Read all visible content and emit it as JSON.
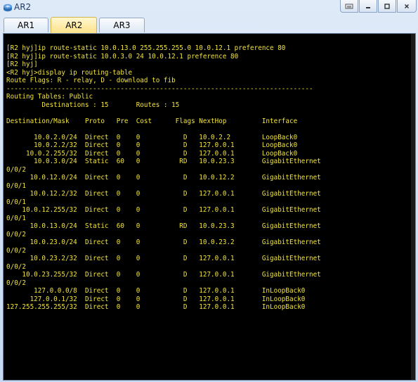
{
  "window": {
    "title": "AR2",
    "icon": "router-icon"
  },
  "tabs": [
    {
      "label": "AR1"
    },
    {
      "label": "AR2",
      "active": true
    },
    {
      "label": "AR3"
    }
  ],
  "terminal": {
    "text_color": "#f2e43a",
    "background": "#000000",
    "lines": [
      "[R2 hyj]ip route-static 10.0.13.0 255.255.255.0 10.0.12.1 preference 80",
      "[R2 hyj]ip route-static 10.0.3.0 24 10.0.12.1 preference 80",
      "[R2 hyj]",
      "<R2 hyj>display ip routing-table",
      "Route Flags: R - relay, D - download to fib",
      "------------------------------------------------------------------------------",
      "Routing Tables: Public",
      "         Destinations : 15       Routes : 15",
      "",
      "Destination/Mask    Proto   Pre  Cost      Flags NextHop         Interface",
      "",
      "       10.0.2.0/24  Direct  0    0           D   10.0.2.2        LoopBack0",
      "       10.0.2.2/32  Direct  0    0           D   127.0.0.1       LoopBack0",
      "     10.0.2.255/32  Direct  0    0           D   127.0.0.1       LoopBack0",
      "       10.0.3.0/24  Static  60   0          RD   10.0.23.3       GigabitEthernet",
      "0/0/2",
      "      10.0.12.0/24  Direct  0    0           D   10.0.12.2       GigabitEthernet",
      "0/0/1",
      "      10.0.12.2/32  Direct  0    0           D   127.0.0.1       GigabitEthernet",
      "0/0/1",
      "    10.0.12.255/32  Direct  0    0           D   127.0.0.1       GigabitEthernet",
      "0/0/1",
      "      10.0.13.0/24  Static  60   0          RD   10.0.23.3       GigabitEthernet",
      "0/0/2",
      "      10.0.23.0/24  Direct  0    0           D   10.0.23.2       GigabitEthernet",
      "0/0/2",
      "      10.0.23.2/32  Direct  0    0           D   127.0.0.1       GigabitEthernet",
      "0/0/2",
      "    10.0.23.255/32  Direct  0    0           D   127.0.0.1       GigabitEthernet",
      "0/0/2",
      "       127.0.0.0/8  Direct  0    0           D   127.0.0.1       InLoopBack0",
      "      127.0.0.1/32  Direct  0    0           D   127.0.0.1       InLoopBack0",
      "127.255.255.255/32  Direct  0    0           D   127.0.0.1       InLoopBack0"
    ]
  }
}
